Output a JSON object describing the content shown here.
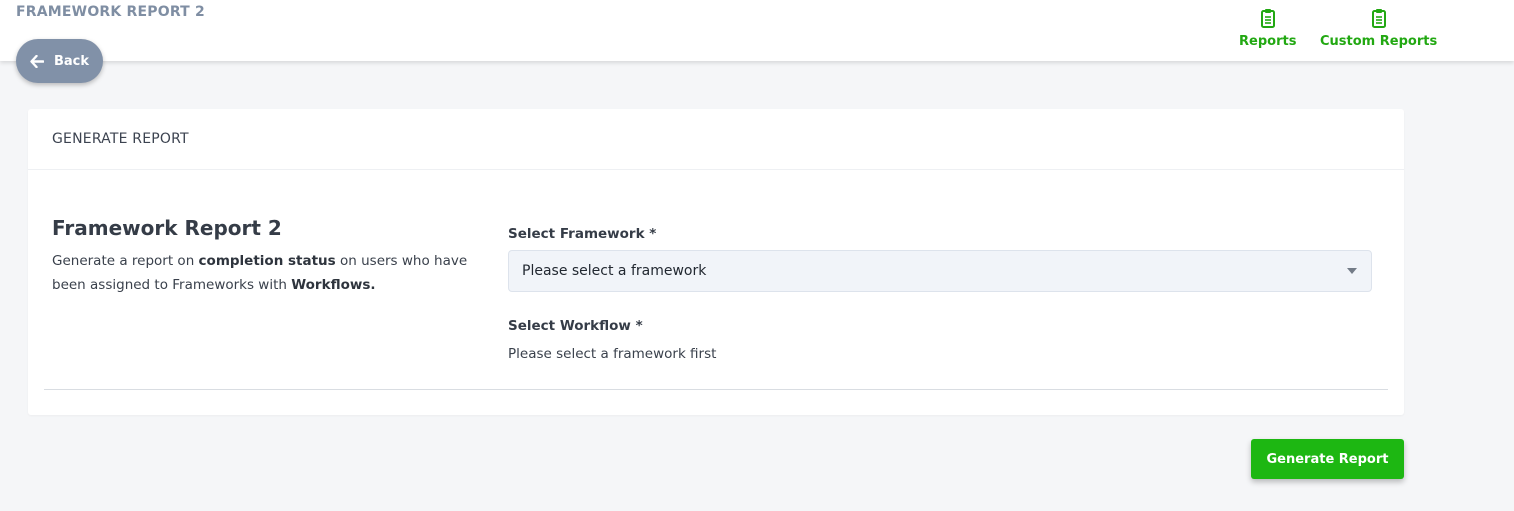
{
  "header": {
    "page_title": "FRAMEWORK REPORT 2",
    "back_label": "Back",
    "nav": {
      "reports_label": "Reports",
      "reports_icon": "clipboard-icon",
      "custom_reports_label": "Custom Reports",
      "custom_reports_icon": "clipboard-icon"
    }
  },
  "card": {
    "header_title": "GENERATE REPORT",
    "report_title": "Framework Report 2",
    "description": {
      "part1": "Generate a report on ",
      "bold1": "completion status",
      "part2": " on users who have been assigned to Frameworks with ",
      "bold2": "Workflows."
    },
    "framework_label": "Select Framework *",
    "framework_placeholder": "Please select a framework",
    "workflow_label": "Select Workflow *",
    "workflow_note": "Please select a framework first"
  },
  "actions": {
    "generate_label": "Generate Report"
  },
  "colors": {
    "accent_green": "#1db712",
    "nav_green": "#22a812",
    "back_button": "#8191a8",
    "page_background": "#f5f6f8"
  }
}
